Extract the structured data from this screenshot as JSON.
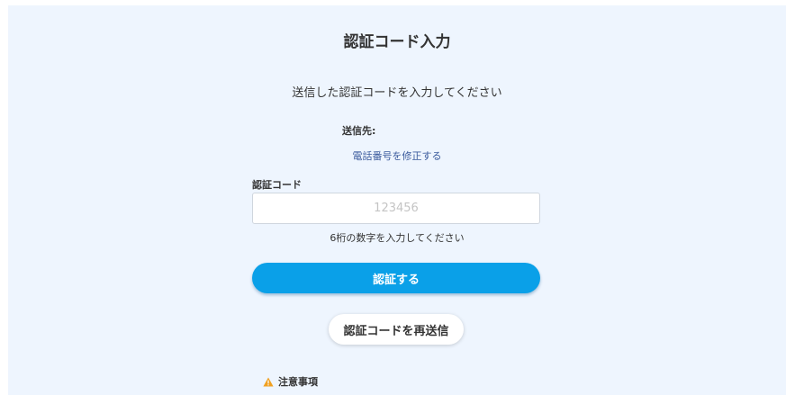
{
  "page": {
    "title": "認証コード入力",
    "instruction": "送信した認証コードを入力してください",
    "destination_label": "送信先:",
    "edit_phone_link": "電話番号を修正する"
  },
  "code_field": {
    "label": "認証コード",
    "placeholder": "123456",
    "value": "",
    "hint": "6桁の数字を入力してください"
  },
  "buttons": {
    "verify_label": "認証する",
    "resend_label": "認証コードを再送信"
  },
  "notes": {
    "title": "注意事項",
    "icon": "warning-icon"
  },
  "colors": {
    "panel_background": "#eef5fe",
    "primary_button": "#0aa0e8",
    "link": "#3a5a9c",
    "warning_icon": "#f0a020"
  }
}
